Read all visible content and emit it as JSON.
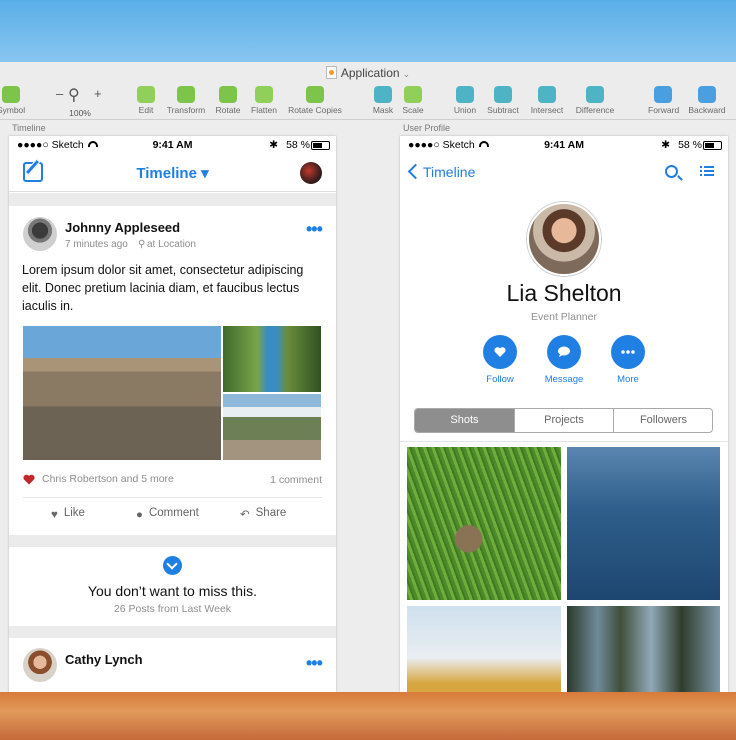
{
  "window": {
    "title": "Application"
  },
  "toolbar": {
    "zoom": {
      "minus": "–",
      "plus": "+",
      "value": "100%"
    },
    "tools": [
      {
        "label": "Symbol",
        "icon": "symbol-icon",
        "color": "#7cc44a"
      },
      {
        "label": "Edit",
        "icon": "edit-icon",
        "color": "#8fcf5a"
      },
      {
        "label": "Transform",
        "icon": "transform-icon",
        "color": "#7cc44a"
      },
      {
        "label": "Rotate",
        "icon": "rotate-icon",
        "color": "#7cc44a"
      },
      {
        "label": "Flatten",
        "icon": "flatten-icon",
        "color": "#8fcf5a"
      },
      {
        "label": "Rotate Copies",
        "icon": "rotate-copies-icon",
        "color": "#7cc44a"
      },
      {
        "label": "Mask",
        "icon": "mask-icon",
        "color": "#4fb3c6"
      },
      {
        "label": "Scale",
        "icon": "scale-icon",
        "color": "#8fcf5a"
      },
      {
        "label": "Union",
        "icon": "union-icon",
        "color": "#4fb3c6"
      },
      {
        "label": "Subtract",
        "icon": "subtract-icon",
        "color": "#4fb3c6"
      },
      {
        "label": "Intersect",
        "icon": "intersect-icon",
        "color": "#4fb3c6"
      },
      {
        "label": "Difference",
        "icon": "difference-icon",
        "color": "#4fb3c6"
      },
      {
        "label": "Forward",
        "icon": "forward-icon",
        "color": "#4a9fe0"
      },
      {
        "label": "Backward",
        "icon": "backward-icon",
        "color": "#4a9fe0"
      }
    ]
  },
  "artboards": {
    "timeline_label": "Timeline",
    "profile_label": "User Profile"
  },
  "status": {
    "carrier": "●●●●○ Sketch",
    "time": "9:41 AM",
    "battery": "58 %",
    "bluetooth": "✱"
  },
  "timeline": {
    "nav_title": "Timeline ▾",
    "post1": {
      "author": "Johnny Appleseed",
      "time": "7 minutes ago",
      "location": "at Location",
      "text": "Lorem ipsum dolor sit amet, consectetur adipiscing elit. Donec pretium lacinia diam, et faucibus lectus iaculis in.",
      "likers": "Chris Robertson and 5 more",
      "comments": "1 comment",
      "actions": {
        "like": "Like",
        "comment": "Comment",
        "share": "Share"
      }
    },
    "digest": {
      "title": "You don’t want to miss this.",
      "subtitle": "26 Posts from Last Week"
    },
    "post2": {
      "author": "Cathy Lynch"
    }
  },
  "profile": {
    "back_label": "Timeline",
    "name": "Lia Shelton",
    "role": "Event Planner",
    "buttons": {
      "follow": "Follow",
      "message": "Message",
      "more": "More"
    },
    "segments": [
      "Shots",
      "Projects",
      "Followers"
    ],
    "selected_segment": "Shots"
  },
  "colors": {
    "accent": "#1f7fe3",
    "like_heart": "#c0292b"
  }
}
